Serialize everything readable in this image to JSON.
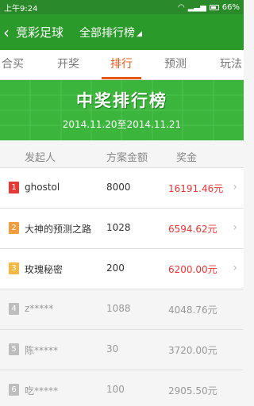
{
  "status": {
    "time": "上午9:24",
    "battery": "66%"
  },
  "appbar": {
    "back_label": "竞彩足球",
    "dropdown_label": "全部排行榜"
  },
  "tabs": [
    {
      "label": "合买",
      "active": false
    },
    {
      "label": "开奖",
      "active": false
    },
    {
      "label": "排行",
      "active": true
    },
    {
      "label": "预测",
      "active": false
    },
    {
      "label": "玩法",
      "active": false
    }
  ],
  "banner": {
    "title": "中奖排行榜",
    "date_range": "2014.11.20至2014.11.21"
  },
  "columns": {
    "initiator": "发起人",
    "amount": "方案金额",
    "prize": "奖金"
  },
  "rows": [
    {
      "rank": "1",
      "name": "ghostol",
      "amount": "8000",
      "prize": "16191.46元",
      "badge_color": "#e53935"
    },
    {
      "rank": "2",
      "name": "大神的预测之路",
      "amount": "1028",
      "prize": "6594.62元",
      "badge_color": "#f39c3d"
    },
    {
      "rank": "3",
      "name": "玫瑰秘密",
      "amount": "200",
      "prize": "6200.00元",
      "badge_color": "#f4b942"
    },
    {
      "rank": "4",
      "name": "z*****",
      "amount": "1088",
      "prize": "4048.76元",
      "badge_color": "#bdbdbd"
    },
    {
      "rank": "5",
      "name": "陈*****",
      "amount": "30",
      "prize": "3720.00元",
      "badge_color": "#bdbdbd"
    },
    {
      "rank": "6",
      "name": "吃*****",
      "amount": "100",
      "prize": "2905.50元",
      "badge_color": "#bdbdbd"
    }
  ],
  "icons": {
    "back": "chevron-left-icon",
    "caret": "caret-down-icon",
    "row_arrow": "chevron-right-icon"
  }
}
